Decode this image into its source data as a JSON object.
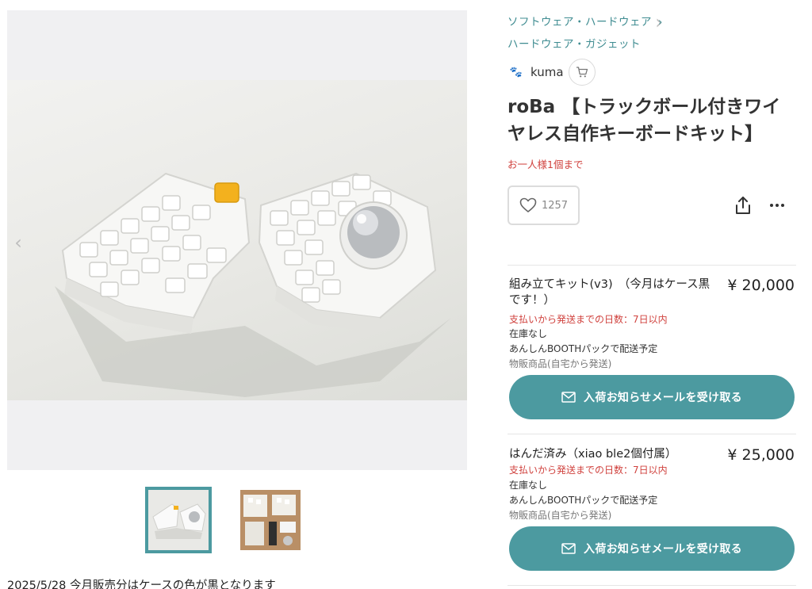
{
  "gallery": {
    "prev_icon": "chevron-left-icon",
    "next_icon": "chevron-right-icon",
    "prev_glyph": "‹",
    "next_glyph": "›",
    "thumbnails": [
      {
        "name": "thumbnail-1",
        "selected": true
      },
      {
        "name": "thumbnail-2",
        "selected": false
      }
    ],
    "accent": "#4c9aa0"
  },
  "description_first_line": "2025/5/28 今月販売分はケースの色が黒となります",
  "breadcrumb": {
    "level1": "ソフトウェア・ハードウェア",
    "level1_chevron": "›",
    "level2": "ハードウェア・ガジェット"
  },
  "shop": {
    "name": "kuma",
    "logo_glyph": "🐾",
    "cart_icon": "cart-icon"
  },
  "product": {
    "title": "roBa 【トラックボール付きワイヤレス自作キーボードキット】",
    "purchase_limit": "お一人様1個まで",
    "likes": "1257"
  },
  "variants": [
    {
      "name": "組み立てキット(v3)　（今月はケース黒です！）",
      "price": "¥ 20,000",
      "ship_days": "支払いから発送までの日数：7日以内",
      "stock": "在庫なし",
      "pack": "あんしんBOOTHパックで配送予定",
      "type": "物販商品(自宅から発送)",
      "button": "入荷お知らせメールを受け取る"
    },
    {
      "name": "はんだ済み（xiao ble2個付属）",
      "price": "¥ 25,000",
      "ship_days": "支払いから発送までの日数：7日以内",
      "stock": "在庫なし",
      "pack": "あんしんBOOTHパックで配送予定",
      "type": "物販商品(自宅から発送)",
      "button": "入荷お知らせメールを受け取る"
    }
  ],
  "colors": {
    "accent": "#4c9aa0",
    "link": "#3f8c91",
    "alert": "#d0423e"
  }
}
